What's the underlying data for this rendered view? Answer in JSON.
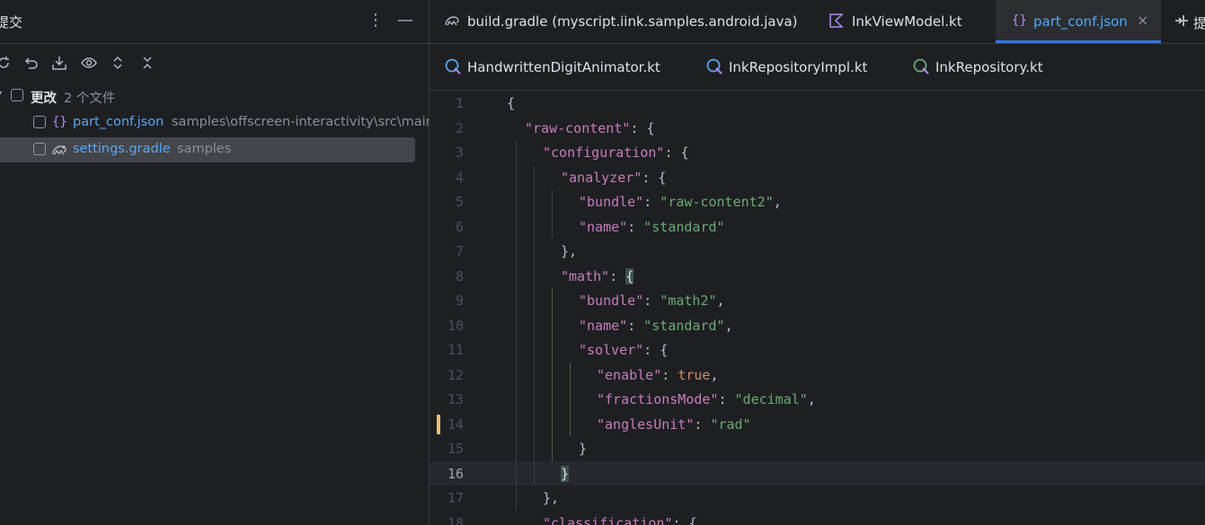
{
  "left_panel": {
    "title": "提交",
    "more_icon": "vertical-dots-icon",
    "minimize_icon": "minus-icon",
    "toolbar": [
      "refresh-icon",
      "rollback-icon",
      "shelve-icon",
      "eye-icon",
      "expand-icon",
      "collapse-icon"
    ],
    "group": {
      "label": "更改",
      "count": "2 个文件"
    },
    "files": [
      {
        "name": "part_conf.json",
        "path": "samples\\offscreen-interactivity\\src\\main",
        "icon": "json-file-icon"
      },
      {
        "name": "settings.gradle",
        "path": "samples",
        "icon": "gradle-file-icon"
      }
    ]
  },
  "tabs_row1": [
    {
      "label": "build.gradle (myscript.iink.samples.android.java)",
      "icon": "gradle-file-icon"
    },
    {
      "label": "InkViewModel.kt",
      "icon": "kotlin-file-icon"
    },
    {
      "label": "part_conf.json",
      "icon": "json-file-icon",
      "active": true,
      "close": "×"
    },
    {
      "label": "提",
      "icon": "split-icon"
    }
  ],
  "tabs_row2": [
    {
      "label": "HandwrittenDigitAnimator.kt",
      "icon": "kotlin-class-icon"
    },
    {
      "label": "InkRepositoryImpl.kt",
      "icon": "kotlin-class-icon"
    },
    {
      "label": "InkRepository.kt",
      "icon": "kotlin-interface-icon"
    }
  ],
  "editor": {
    "current_line": 16,
    "modified_line": 14,
    "lines": [
      {
        "n": "1",
        "i": 0,
        "t": [
          [
            "p",
            "{"
          ]
        ]
      },
      {
        "n": "2",
        "i": 1,
        "t": [
          [
            "k",
            "\"raw-content\""
          ],
          [
            "p",
            ": {"
          ]
        ]
      },
      {
        "n": "3",
        "i": 2,
        "t": [
          [
            "k",
            "\"configuration\""
          ],
          [
            "p",
            ": {"
          ]
        ]
      },
      {
        "n": "4",
        "i": 3,
        "t": [
          [
            "k",
            "\"analyzer\""
          ],
          [
            "p",
            ": {"
          ]
        ]
      },
      {
        "n": "5",
        "i": 4,
        "t": [
          [
            "k",
            "\"bundle\""
          ],
          [
            "p",
            ": "
          ],
          [
            "s",
            "\"raw-content2\""
          ],
          [
            "p",
            ","
          ]
        ]
      },
      {
        "n": "6",
        "i": 4,
        "t": [
          [
            "k",
            "\"name\""
          ],
          [
            "p",
            ": "
          ],
          [
            "s",
            "\"standard\""
          ]
        ]
      },
      {
        "n": "7",
        "i": 3,
        "t": [
          [
            "p",
            "},"
          ]
        ]
      },
      {
        "n": "8",
        "i": 3,
        "t": [
          [
            "k",
            "\"math\""
          ],
          [
            "p",
            ": "
          ],
          [
            "h",
            "{"
          ]
        ]
      },
      {
        "n": "9",
        "i": 4,
        "t": [
          [
            "k",
            "\"bundle\""
          ],
          [
            "p",
            ": "
          ],
          [
            "s",
            "\"math2\""
          ],
          [
            "p",
            ","
          ]
        ]
      },
      {
        "n": "10",
        "i": 4,
        "t": [
          [
            "k",
            "\"name\""
          ],
          [
            "p",
            ": "
          ],
          [
            "s",
            "\"standard\""
          ],
          [
            "p",
            ","
          ]
        ]
      },
      {
        "n": "11",
        "i": 4,
        "t": [
          [
            "k",
            "\"solver\""
          ],
          [
            "p",
            ": {"
          ]
        ]
      },
      {
        "n": "12",
        "i": 5,
        "t": [
          [
            "k",
            "\"enable\""
          ],
          [
            "p",
            ": "
          ],
          [
            "kw",
            "true"
          ],
          [
            "p",
            ","
          ]
        ]
      },
      {
        "n": "13",
        "i": 5,
        "t": [
          [
            "k",
            "\"fractionsMode\""
          ],
          [
            "p",
            ": "
          ],
          [
            "s",
            "\"decimal\""
          ],
          [
            "p",
            ","
          ]
        ]
      },
      {
        "n": "14",
        "i": 5,
        "t": [
          [
            "k",
            "\"anglesUnit\""
          ],
          [
            "p",
            ": "
          ],
          [
            "s",
            "\"rad\""
          ]
        ]
      },
      {
        "n": "15",
        "i": 4,
        "t": [
          [
            "p",
            "}"
          ]
        ]
      },
      {
        "n": "16",
        "i": 3,
        "t": [
          [
            "h",
            "}"
          ]
        ]
      },
      {
        "n": "17",
        "i": 2,
        "t": [
          [
            "p",
            "},"
          ]
        ]
      },
      {
        "n": "18",
        "i": 2,
        "t": [
          [
            "k",
            "\"classification\""
          ],
          [
            "p",
            ": {"
          ]
        ]
      }
    ]
  },
  "colors": {
    "accent": "#3574f0",
    "json_key": "#c77dbb",
    "json_string": "#6aab73",
    "keyword": "#cf8e6d",
    "modified": "#e5c07b"
  }
}
